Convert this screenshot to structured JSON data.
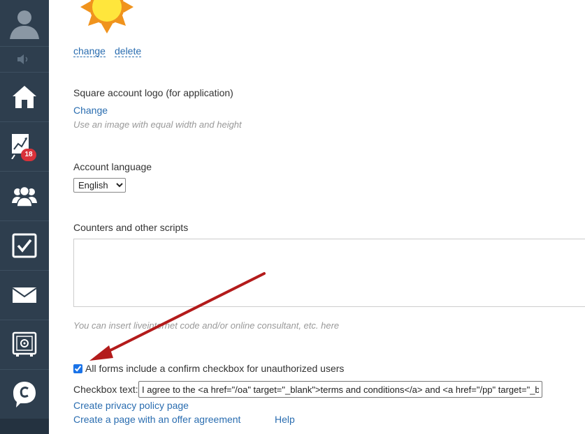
{
  "sidebar": {
    "items": [
      {
        "name": "avatar",
        "icon": "user-avatar-icon"
      },
      {
        "name": "sound",
        "icon": "speaker-icon"
      },
      {
        "name": "home",
        "icon": "home-icon"
      },
      {
        "name": "stats",
        "icon": "chart-icon",
        "badge": "18"
      },
      {
        "name": "users",
        "icon": "users-icon"
      },
      {
        "name": "tasks",
        "icon": "checkbox-icon"
      },
      {
        "name": "mail",
        "icon": "envelope-icon"
      },
      {
        "name": "safe",
        "icon": "safe-icon"
      },
      {
        "name": "chat",
        "icon": "chat-icon"
      }
    ],
    "colors": {
      "background": "#2e3e4e",
      "badge": "#d9323a"
    }
  },
  "logo": {
    "change_label": "change",
    "delete_label": "delete"
  },
  "square_logo": {
    "title": "Square account logo (for application)",
    "change_label": "Change",
    "hint": "Use an image with equal width and height"
  },
  "language": {
    "title": "Account language",
    "selected": "English"
  },
  "scripts": {
    "title": "Counters and other scripts",
    "value": "",
    "hint": "You can insert liveinternet code and/or online consultant, etc. here"
  },
  "confirm": {
    "checked": true,
    "label": "All forms include a confirm checkbox for unauthorized users",
    "text_label": "Checkbox text:",
    "text_value": "I agree to the <a href=\"/oa\" target=\"_blank\">terms and conditions</a> and <a href=\"/pp\" target=\"_blank\">privacy policy</a>"
  },
  "links": {
    "privacy": "Create privacy policy page",
    "offer": "Create a page with an offer agreement",
    "help": "Help"
  },
  "colors": {
    "link": "#2a6db0",
    "annotation_arrow": "#b31b1b"
  }
}
